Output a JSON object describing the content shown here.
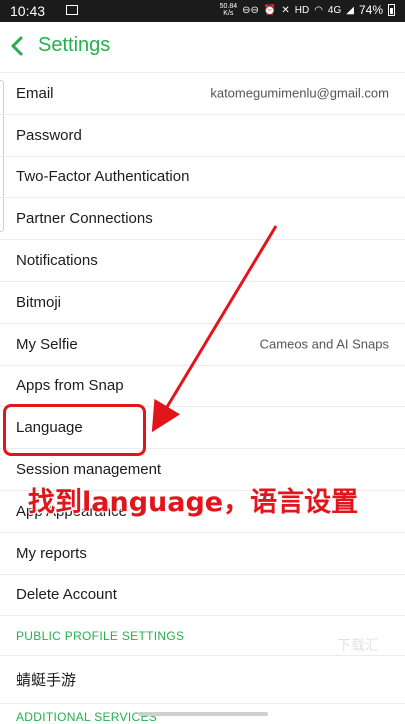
{
  "status_bar": {
    "time": "10:43",
    "net_speed_value": "50.84",
    "net_speed_unit": "K/s",
    "icons": [
      "image-icon",
      "vr-icon",
      "alarm-icon",
      "mute-icon",
      "hd-icon",
      "wifi-icon",
      "signal-icon",
      "battery-icon"
    ],
    "hd_label": "HD",
    "network_label": "4G",
    "battery_percent": "74%"
  },
  "header": {
    "back_icon": "chevron-left-icon",
    "title": "Settings"
  },
  "settings": [
    {
      "label": "Email",
      "value": "katomegumimenlu@gmail.com"
    },
    {
      "label": "Password",
      "value": ""
    },
    {
      "label": "Two-Factor Authentication",
      "value": ""
    },
    {
      "label": "Partner Connections",
      "value": ""
    },
    {
      "label": "Notifications",
      "value": ""
    },
    {
      "label": "Bitmoji",
      "value": ""
    },
    {
      "label": "My Selfie",
      "value": "Cameos and AI Snaps"
    },
    {
      "label": "Apps from Snap",
      "value": ""
    },
    {
      "label": "Language",
      "value": ""
    },
    {
      "label": "Session management",
      "value": ""
    },
    {
      "label": "App Appearance",
      "value": ""
    },
    {
      "label": "My reports",
      "value": ""
    },
    {
      "label": "Delete Account",
      "value": ""
    }
  ],
  "public_profile_section": {
    "title": "PUBLIC PROFILE SETTINGS",
    "items": [
      {
        "label": "蜻蜓手游"
      }
    ]
  },
  "additional_section": {
    "title": "ADDITIONAL SERVICES"
  },
  "annotation": {
    "text": "找到language，语言设置",
    "color": "#e0161b"
  },
  "watermark": "下载汇",
  "colors": {
    "accent": "#22b14c",
    "highlight": "#e0161b"
  }
}
